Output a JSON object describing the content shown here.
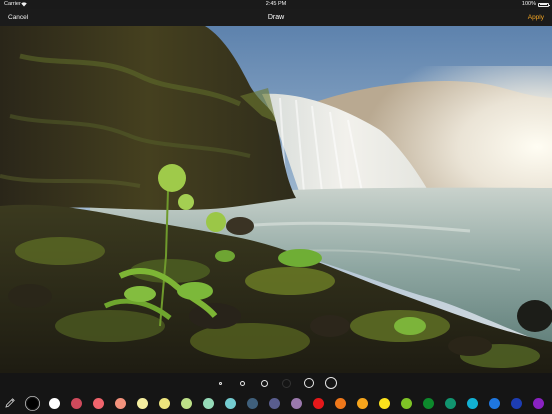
{
  "status_bar": {
    "carrier": "Carrier",
    "time": "2:45 PM",
    "battery": "100%"
  },
  "nav": {
    "cancel_label": "Cancel",
    "title": "Draw",
    "apply_label": "Apply"
  },
  "brush_sizes": [
    {
      "name": "brush-size-1",
      "state": "normal"
    },
    {
      "name": "brush-size-2",
      "state": "normal"
    },
    {
      "name": "brush-size-3",
      "state": "normal"
    },
    {
      "name": "brush-size-4",
      "state": "disabled"
    },
    {
      "name": "brush-size-5",
      "state": "normal"
    },
    {
      "name": "brush-size-6",
      "state": "normal"
    }
  ],
  "tool": {
    "icon": "pencil-icon"
  },
  "palette": [
    {
      "name": "black",
      "color": "#000000",
      "selected": true
    },
    {
      "name": "white",
      "color": "#ffffff"
    },
    {
      "name": "rose",
      "color": "#cf4a5c"
    },
    {
      "name": "coral-red",
      "color": "#f0646c"
    },
    {
      "name": "salmon",
      "color": "#f3927c"
    },
    {
      "name": "pale-yellow",
      "color": "#f6efa0"
    },
    {
      "name": "light-yellow",
      "color": "#ece47d"
    },
    {
      "name": "light-green",
      "color": "#bde088"
    },
    {
      "name": "mint",
      "color": "#96dbb8"
    },
    {
      "name": "aqua",
      "color": "#74ccd0"
    },
    {
      "name": "slate-blue",
      "color": "#3f5f7b"
    },
    {
      "name": "muted-purple",
      "color": "#595d8e"
    },
    {
      "name": "lavender",
      "color": "#9b79ad"
    },
    {
      "name": "red",
      "color": "#e6181a"
    },
    {
      "name": "orange",
      "color": "#f0781a"
    },
    {
      "name": "amber",
      "color": "#f7a51c"
    },
    {
      "name": "yellow",
      "color": "#fde31c"
    },
    {
      "name": "green",
      "color": "#7ec326"
    },
    {
      "name": "dark-green",
      "color": "#0d8a2c"
    },
    {
      "name": "teal",
      "color": "#11956f"
    },
    {
      "name": "cyan",
      "color": "#12b1d3"
    },
    {
      "name": "blue",
      "color": "#1f77df"
    },
    {
      "name": "navy",
      "color": "#1d3db3"
    },
    {
      "name": "purple",
      "color": "#8a22c2"
    }
  ]
}
